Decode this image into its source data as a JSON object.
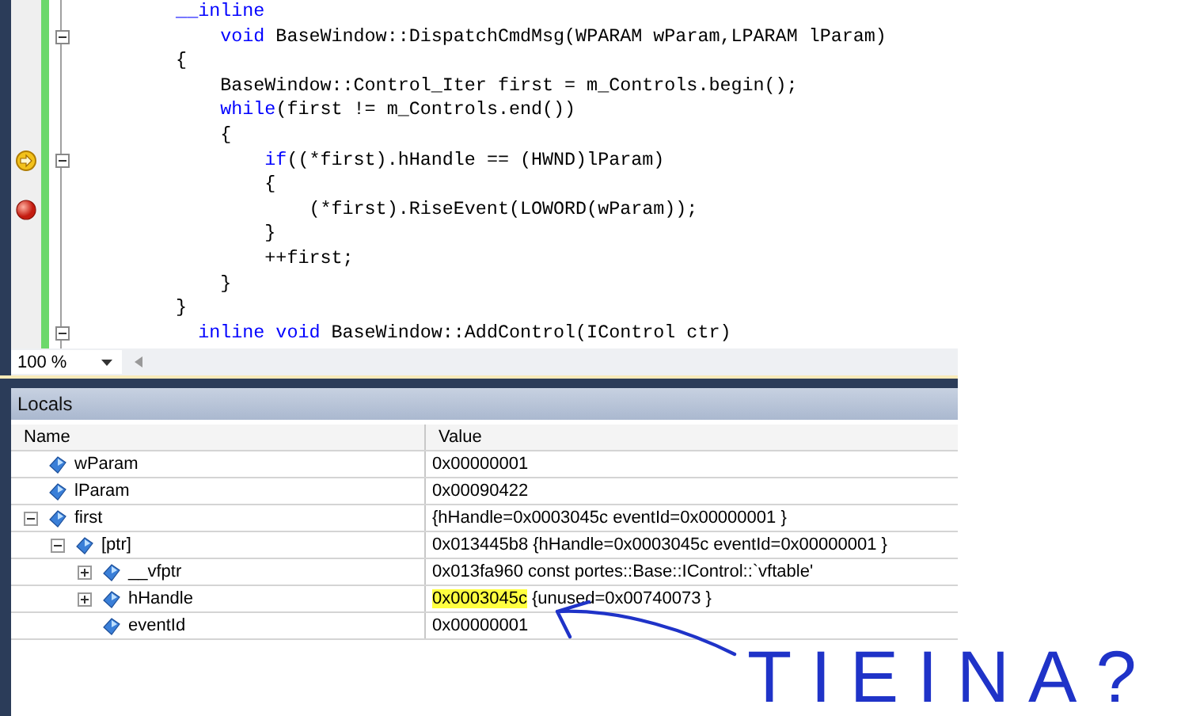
{
  "editor": {
    "lines": [
      {
        "segments": [
          {
            "text": "    __inline",
            "kind": "keyword"
          }
        ]
      },
      {
        "fold": true,
        "segments": [
          {
            "text": "        void",
            "kind": "keyword"
          },
          {
            "text": " BaseWindow::DispatchCmdMsg(WPARAM wParam,LPARAM lParam)"
          }
        ]
      },
      {
        "segments": [
          {
            "text": "    {"
          }
        ]
      },
      {
        "segments": [
          {
            "text": "        BaseWindow::Control_Iter first = m_Controls.begin();"
          }
        ]
      },
      {
        "segments": [
          {
            "text": "        while",
            "kind": "keyword"
          },
          {
            "text": "(first != m_Controls.end())"
          }
        ]
      },
      {
        "segments": [
          {
            "text": "        {"
          }
        ]
      },
      {
        "current_statement": true,
        "fold": true,
        "segments": [
          {
            "text": "            if",
            "kind": "keyword"
          },
          {
            "text": "((*first).hHandle == (HWND)lParam)"
          }
        ]
      },
      {
        "segments": [
          {
            "text": "            {"
          }
        ]
      },
      {
        "breakpoint": true,
        "segments": [
          {
            "text": "                (*first).RiseEvent(LOWORD(wParam));"
          }
        ]
      },
      {
        "segments": [
          {
            "text": "            }"
          }
        ]
      },
      {
        "segments": [
          {
            "text": "            ++first;"
          }
        ]
      },
      {
        "segments": [
          {
            "text": "        }"
          }
        ]
      },
      {
        "segments": [
          {
            "text": "    }"
          }
        ]
      },
      {
        "fold": true,
        "segments": [
          {
            "text": "      inline void",
            "kind": "keyword"
          },
          {
            "text": " BaseWindow::AddControl(IControl ctr)"
          }
        ]
      }
    ],
    "zoom": "100 %"
  },
  "locals": {
    "title": "Locals",
    "columns": [
      "Name",
      "Value"
    ],
    "rows": [
      {
        "name": "wParam",
        "value": "0x00000001"
      },
      {
        "name": "lParam",
        "value": "0x00090422"
      },
      {
        "name": "first",
        "value": "{hHandle=0x0003045c eventId=0x00000001 }",
        "expanded": true,
        "children": [
          {
            "name": "[ptr]",
            "value": "0x013445b8 {hHandle=0x0003045c eventId=0x00000001 }",
            "expanded": true,
            "children": [
              {
                "name": "__vfptr",
                "value": "0x013fa960 const portes::Base::IControl::`vftable'",
                "expanded": false
              },
              {
                "name": "hHandle",
                "highlight": "0x0003045c",
                "value": "{unused=0x00740073 }",
                "expanded": false
              },
              {
                "name": "eventId",
                "value": "0x00000001"
              }
            ]
          }
        ]
      }
    ]
  },
  "annotation": {
    "text": "TIEINA?"
  }
}
